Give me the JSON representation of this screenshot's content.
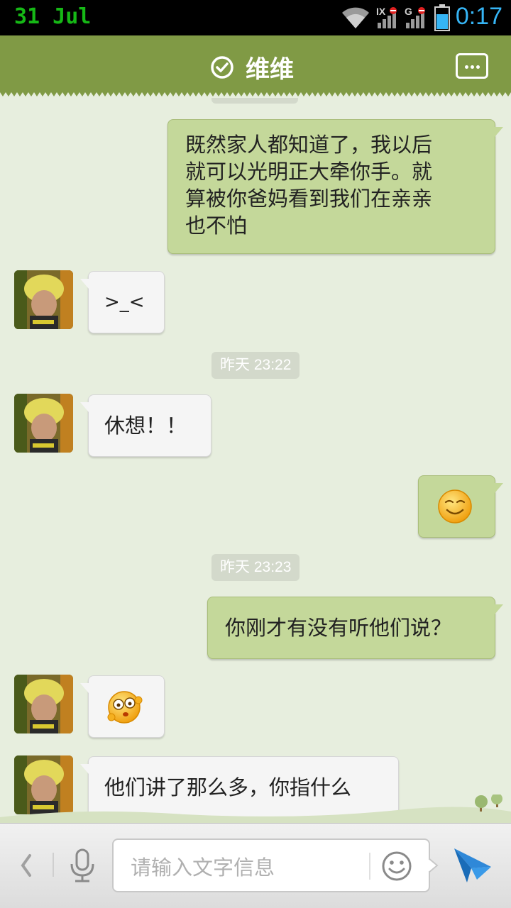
{
  "status_bar": {
    "date": "31 Jul",
    "time": "0:17",
    "network_label_1": "IX",
    "network_label_2": "G",
    "icons": [
      "wifi-icon",
      "signal-icon",
      "signal-icon",
      "battery-icon"
    ]
  },
  "header": {
    "title": "维维",
    "icons": [
      "verified-check-icon",
      "more-options-icon"
    ],
    "accent_color": "#809a45"
  },
  "messages": [
    {
      "side": "right",
      "type": "text",
      "lines": [
        "既然家人都知道了，我以后",
        "就可以光明正大牵你手。就",
        "算被你爸妈看到我们在亲亲",
        "也不怕"
      ]
    },
    {
      "side": "left",
      "type": "text",
      "text": ">_<"
    },
    {
      "type": "timestamp",
      "text": "昨天 23:22"
    },
    {
      "side": "left",
      "type": "text",
      "text": "休想！！"
    },
    {
      "side": "right",
      "type": "emoji",
      "icon": "content-smile-emoji-icon"
    },
    {
      "type": "timestamp",
      "text": "昨天 23:23"
    },
    {
      "side": "right",
      "type": "text",
      "text": "你刚才有没有听他们说？"
    },
    {
      "side": "left",
      "type": "emoji",
      "icon": "dizzy-emoji-icon"
    },
    {
      "side": "left",
      "type": "text",
      "text": "他们讲了那么多，你指什么"
    }
  ],
  "input_bar": {
    "placeholder": "请输入文字信息",
    "icons": [
      "back-chevron-icon",
      "microphone-icon",
      "emoji-smiley-icon",
      "send-icon"
    ]
  },
  "colors": {
    "sent_bubble": "#c4d89a",
    "received_bubble": "#f5f5f5",
    "chat_background": "#e7eede",
    "timestamp_bg": "#d3d9cb"
  }
}
